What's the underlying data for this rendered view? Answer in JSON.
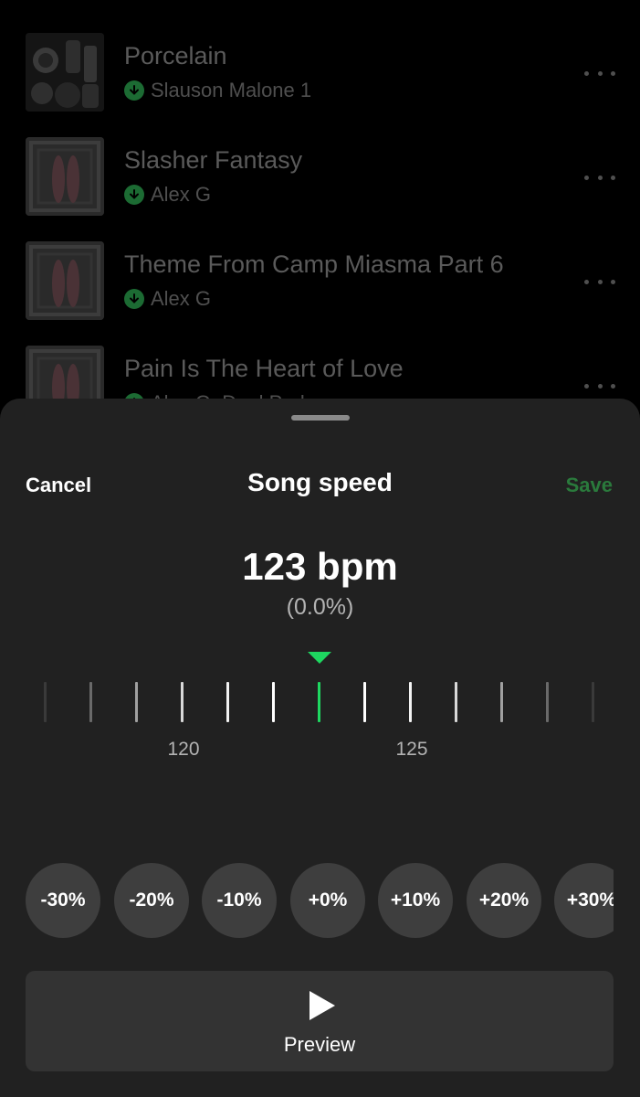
{
  "tracks": [
    {
      "title": "Porcelain",
      "artist": "Slauson Malone 1"
    },
    {
      "title": "Slasher Fantasy",
      "artist": "Alex G"
    },
    {
      "title": "Theme From Camp Miasma Part 6",
      "artist": "Alex G"
    },
    {
      "title": "Pain Is The Heart of Love",
      "artist": "Alex G, Dual Park"
    }
  ],
  "sheet": {
    "cancel_label": "Cancel",
    "title": "Song speed",
    "save_label": "Save",
    "bpm_text": "123 bpm",
    "percent_text": "(0.0%)",
    "tick_labels": [
      "120",
      "125"
    ],
    "presets": [
      "-30%",
      "-20%",
      "-10%",
      "+0%",
      "+10%",
      "+20%",
      "+30%"
    ],
    "preview_label": "Preview"
  },
  "colors": {
    "accent": "#1ed760",
    "save_disabled": "#2a7a3c",
    "sheet_bg": "#212121",
    "button_bg": "#3e3e3e"
  },
  "icons": {
    "track_download": "download-icon",
    "track_more": "more-icon",
    "preview": "play-icon",
    "selector": "triangle-down-icon"
  }
}
